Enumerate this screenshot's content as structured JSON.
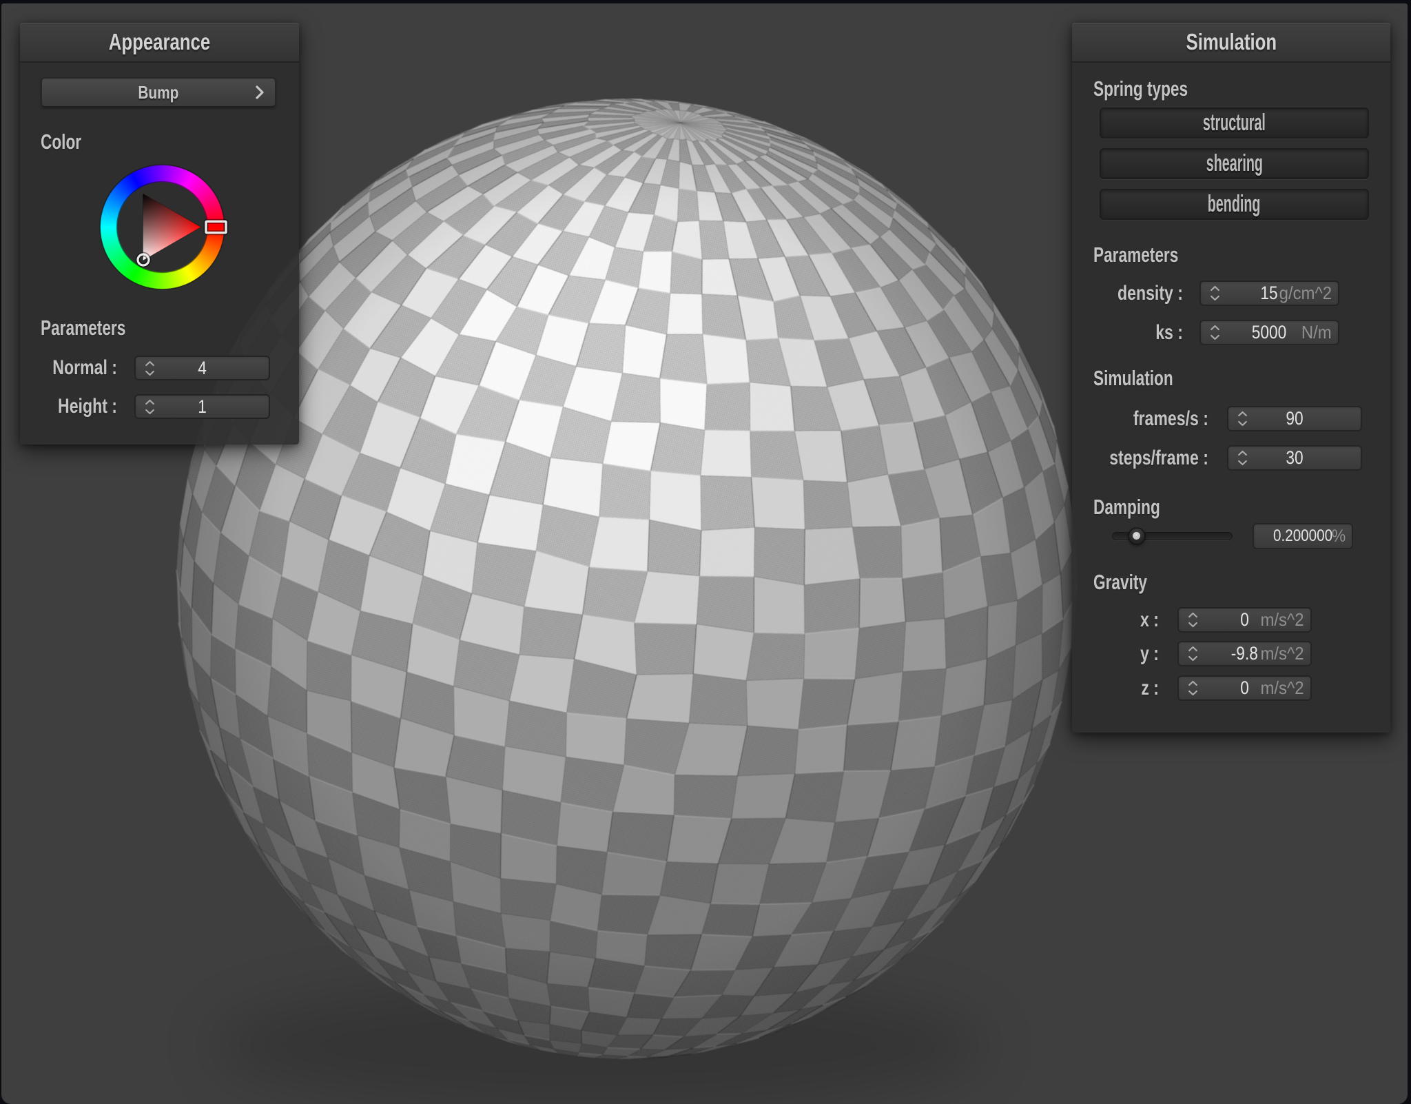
{
  "appearance": {
    "title": "Appearance",
    "bump_button": {
      "label": "Bump"
    },
    "color_label": "Color",
    "color_wheel": {
      "hue_deg": 0,
      "hue_color": "#ff0000",
      "selected_color": "white"
    },
    "parameters_label": "Parameters",
    "fields": {
      "normal": {
        "label": "Normal :",
        "value": "4"
      },
      "height": {
        "label": "Height :",
        "value": "1"
      }
    }
  },
  "simulation": {
    "title": "Simulation",
    "spring_types": {
      "label": "Spring types",
      "buttons": [
        {
          "label": "structural",
          "pressed": true
        },
        {
          "label": "shearing",
          "pressed": true
        },
        {
          "label": "bending",
          "pressed": true
        }
      ]
    },
    "parameters_label": "Parameters",
    "fields": {
      "density": {
        "label": "density :",
        "value": "15",
        "units": "g/cm^2"
      },
      "ks": {
        "label": "ks :",
        "value": "5000",
        "units": "N/m"
      }
    },
    "simulation_label": "Simulation",
    "sim_fields": {
      "frames": {
        "label": "frames/s :",
        "value": "90"
      },
      "steps": {
        "label": "steps/frame :",
        "value": "30"
      }
    },
    "damping": {
      "label": "Damping",
      "slider_value": 0.2,
      "box_value": "0.200000",
      "units": "%"
    },
    "gravity": {
      "label": "Gravity",
      "fields": {
        "x": {
          "label": "x :",
          "value": "0",
          "units": "m/s^2"
        },
        "y": {
          "label": "y :",
          "value": "-9.8",
          "units": "m/s^2"
        },
        "z": {
          "label": "z :",
          "value": "0",
          "units": "m/s^2"
        }
      }
    }
  },
  "scene": {
    "object": "cloth-draped sphere with checkered woven fabric"
  }
}
